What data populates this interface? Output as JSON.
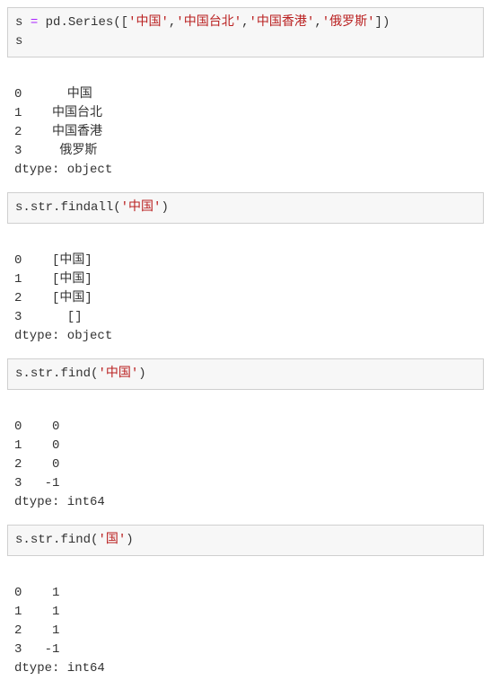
{
  "cells": [
    {
      "code": {
        "t0_var": "s",
        "t1_sp": " ",
        "t2_op": "=",
        "t3_sp": " ",
        "t4_ns": "pd",
        "t5_dot": ".",
        "t6_fn": "Series",
        "t7_open": "([",
        "t8_str1": "'中国'",
        "t9_c1": ",",
        "t10_str2": "'中国台北'",
        "t11_c2": ",",
        "t12_str3": "'中国香港'",
        "t13_c3": ",",
        "t14_str4": "'俄罗斯'",
        "t15_close": "])",
        "line2": "s"
      },
      "output": "\n0      中国\n1    中国台北\n2    中国香港\n3     俄罗斯\ndtype: object"
    },
    {
      "code": {
        "t0_var": "s",
        "t1_dot": ".",
        "t2_ns": "str",
        "t3_dot2": ".",
        "t4_fn": "findall",
        "t5_open": "(",
        "t6_str": "'中国'",
        "t7_close": ")"
      },
      "output": "\n0    [中国]\n1    [中国]\n2    [中国]\n3      []\ndtype: object"
    },
    {
      "code": {
        "t0_var": "s",
        "t1_dot": ".",
        "t2_ns": "str",
        "t3_dot2": ".",
        "t4_fn": "find",
        "t5_open": "(",
        "t6_str": "'中国'",
        "t7_close": ")"
      },
      "output": "\n0    0\n1    0\n2    0\n3   -1\ndtype: int64"
    },
    {
      "code": {
        "t0_var": "s",
        "t1_dot": ".",
        "t2_ns": "str",
        "t3_dot2": ".",
        "t4_fn": "find",
        "t5_open": "(",
        "t6_str": "'国'",
        "t7_close": ")"
      },
      "output": "\n0    1\n1    1\n2    1\n3   -1\ndtype: int64"
    }
  ]
}
